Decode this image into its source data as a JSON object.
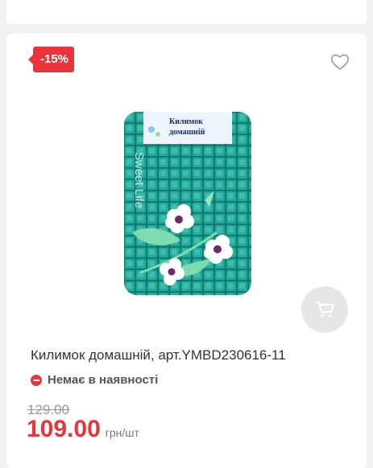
{
  "product": {
    "discount_badge": "-15%",
    "title": "Килимок домашній, арт.YMBD230616-11",
    "stock_status": "Немає в наявності",
    "old_price": "129.00",
    "price": "109.00",
    "price_unit": "грн/шт",
    "image": {
      "label_line1": "Килимок",
      "label_line2": "домашній",
      "vertical_text": "Sweet Life"
    }
  },
  "icons": {
    "wishlist": "heart-outline-icon",
    "cart": "cart-icon",
    "stock": "minus-circle-icon"
  },
  "colors": {
    "accent": "#e8343a",
    "mat_teal": "#1aa89a"
  }
}
